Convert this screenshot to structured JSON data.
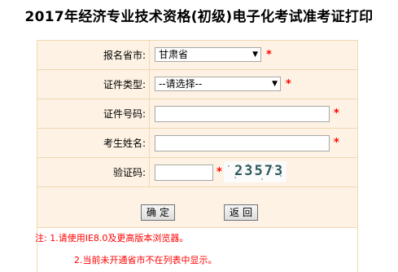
{
  "title": "2017年经济专业技术资格(初级)电子化考试准考证打印",
  "form": {
    "province_label": "报名省市:",
    "province_value": "甘肃省",
    "id_type_label": "证件类型:",
    "id_type_value": "--请选择--",
    "id_number_label": "证件号码:",
    "id_number_value": "",
    "name_label": "考生姓名:",
    "name_value": "",
    "captcha_label": "验证码:",
    "captcha_value": "",
    "captcha_text": "23573",
    "required_mark": "*"
  },
  "buttons": {
    "confirm": "确定",
    "back": "返回"
  },
  "notes": {
    "line1": "注: 1.请使用IE8.0及更高版本浏览器。",
    "line2": "2.当前未开通省市不在列表中显示。"
  },
  "colors": {
    "form_bg": "#fdf2e3",
    "border": "#f3d7b3",
    "required": "#ff0000",
    "note": "#ff0000"
  }
}
